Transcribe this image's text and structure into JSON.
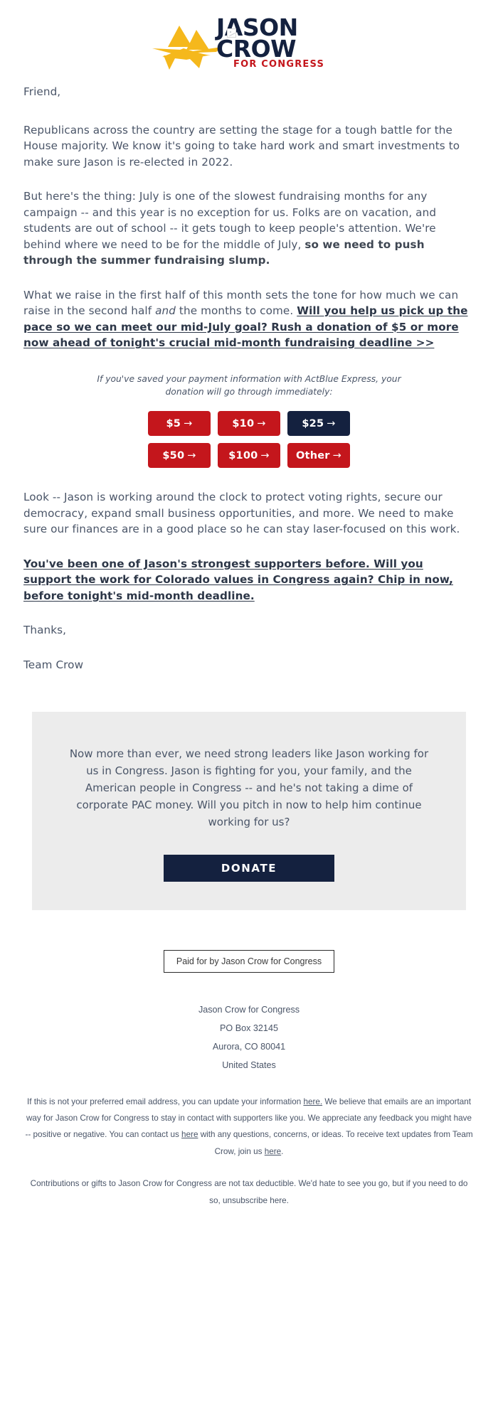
{
  "header": {
    "logo_line1": "JASON",
    "logo_line2": "CROW",
    "logo_line3": "FOR CONGRESS",
    "broken_image_icon": "broken-image-icon",
    "colors": {
      "navy": "#14213f",
      "gold": "#f5b81c",
      "red": "#c4161c"
    }
  },
  "body": {
    "salutation": "Friend,",
    "p1": "Republicans across the country are setting the stage for a tough battle for the House majority. We know it's going to take hard work and smart investments to make sure Jason is re-elected in 2022.",
    "p2_a": "But here's the thing: July is one of the slowest fundraising months for any campaign -- and this year is no exception for us. Folks are on vacation, and students are out of school -- it gets tough to keep people's attention. We're behind where we need to be for the middle of July, ",
    "p2_bold": "so we need to push through the summer fundraising slump.",
    "p3_a": "What we raise in the first half of this month sets the tone for how much we can raise in the second half ",
    "p3_italic": "and",
    "p3_b": " the months to come. ",
    "p3_link": "Will you help us pick up the pace so we can meet our mid-July goal? Rush a donation of $5 or more now ahead of tonight's crucial mid-month fundraising deadline >>",
    "p4": "Look -- Jason is working around the clock to protect voting rights, secure our democracy, expand small business opportunities, and more. We need to make sure our finances are in a good place so he can stay laser-focused on this work.",
    "p5_link": "You've been one of Jason's strongest supporters before. Will you support the work for Colorado values in Congress again? Chip in now, before tonight's mid-month deadline.",
    "signoff": "Thanks,",
    "team": "Team Crow"
  },
  "express_note": "If you've saved your payment information with ActBlue Express, your donation will go through immediately:",
  "amounts": {
    "rows": [
      [
        {
          "label": "$5",
          "arrow": "→",
          "style": "red"
        },
        {
          "label": "$10",
          "arrow": "→",
          "style": "red"
        },
        {
          "label": "$25",
          "arrow": "→",
          "style": "navy"
        }
      ],
      [
        {
          "label": "$50",
          "arrow": "→",
          "style": "red"
        },
        {
          "label": "$100",
          "arrow": "→",
          "style": "red"
        },
        {
          "label": "Other",
          "arrow": "→",
          "style": "red"
        }
      ]
    ]
  },
  "callout": {
    "text": "Now more than ever, we need strong leaders like Jason working for us in Congress. Jason is fighting for you, your family, and the American people in Congress -- and he's not taking a dime of corporate PAC money. Will you pitch in now to help him continue working for us?",
    "donate_label": "DONATE"
  },
  "paid_for": "Paid for by Jason Crow for Congress",
  "address": {
    "line1": "Jason Crow for Congress",
    "line2": "PO Box 32145",
    "line3": "Aurora, CO 80041",
    "line4": "United States"
  },
  "fineprint": {
    "p1_a": "If this is not your preferred email address, you can update your information ",
    "p1_link1": "here.",
    "p1_b": " We believe that emails are an important way for Jason Crow for Congress to stay in contact with supporters like you. We appreciate any feedback you might have -- positive or negative. You can contact us ",
    "p1_link2": "here",
    "p1_c": " with any questions, concerns, or ideas. To receive text updates from Team Crow, join us ",
    "p1_link3": "here",
    "p1_d": ".",
    "p2_a": "Contributions or gifts to Jason Crow for Congress are not tax deductible. We'd hate to see you go, but if you need to do so, ",
    "p2_link": "unsubscribe here",
    "p2_b": "."
  }
}
